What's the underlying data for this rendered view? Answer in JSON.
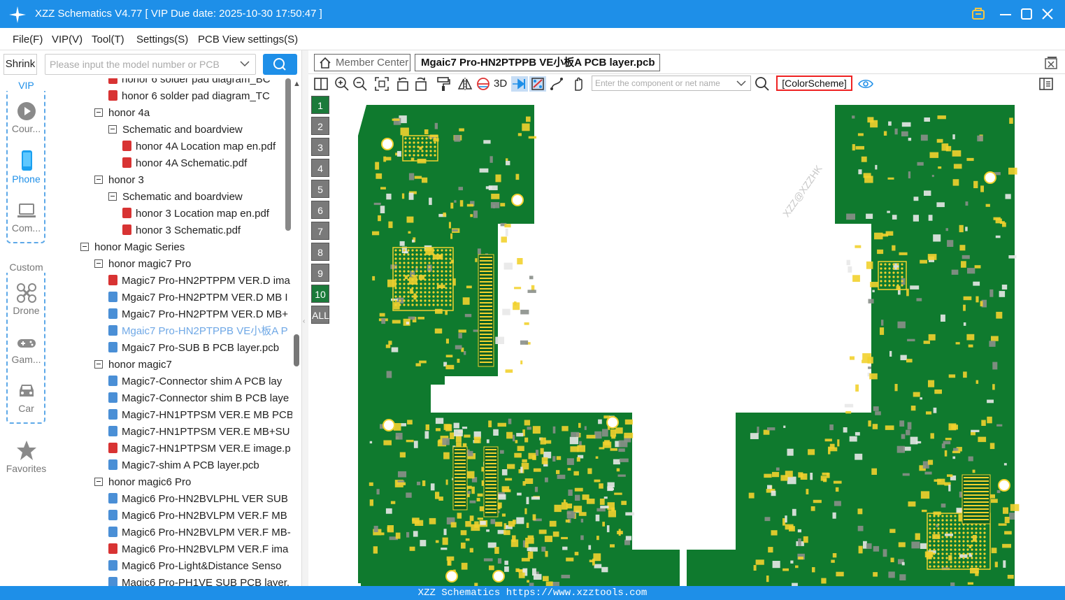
{
  "app": {
    "title": "XZZ Schematics V4.77 [ VIP Due date: 2025-10-30 17:50:47 ]",
    "accent": "#1e8fe8",
    "icons": [
      "app-logo-icon",
      "vip-icon",
      "minimize-icon",
      "maximize-icon",
      "close-icon"
    ]
  },
  "menu": [
    "File(F)",
    "VIP(V)",
    "Tool(T)",
    "Settings(S)",
    "PCB View settings(S)"
  ],
  "search": {
    "shrink_label": "Shrink",
    "placeholder": "Please input the model number or PCB"
  },
  "rail": {
    "vip_label": "VIP",
    "custom_label": "Custom",
    "items": [
      {
        "label": "Cour...",
        "icon": "play-icon"
      },
      {
        "label": "Phone",
        "icon": "phone-icon"
      },
      {
        "label": "Com...",
        "icon": "laptop-icon"
      },
      {
        "label": "Drone",
        "icon": "drone-icon"
      },
      {
        "label": "Gam...",
        "icon": "gamepad-icon"
      },
      {
        "label": "Car",
        "icon": "car-icon"
      },
      {
        "label": "Favorites",
        "icon": "star-icon"
      }
    ]
  },
  "tree": [
    {
      "label": "honor 6 solder pad diagram_BC",
      "type": "pdf",
      "level": 3
    },
    {
      "label": "honor 6 solder pad diagram_TC",
      "type": "pdf",
      "level": 3
    },
    {
      "label": "honor 4a",
      "type": "folder",
      "level": 2
    },
    {
      "label": "Schematic and boardview",
      "type": "folder",
      "level": 3
    },
    {
      "label": "honor 4A Location map en.pdf",
      "type": "pdf",
      "level": 4
    },
    {
      "label": "honor 4A Schematic.pdf",
      "type": "pdf",
      "level": 4
    },
    {
      "label": "honor 3",
      "type": "folder",
      "level": 2
    },
    {
      "label": "Schematic and boardview",
      "type": "folder",
      "level": 3
    },
    {
      "label": "honor 3 Location map en.pdf",
      "type": "pdf",
      "level": 4
    },
    {
      "label": "honor 3 Schematic.pdf",
      "type": "pdf",
      "level": 4
    },
    {
      "label": "honor Magic Series",
      "type": "folder",
      "level": 1
    },
    {
      "label": "honor magic7 Pro",
      "type": "folder",
      "level": 2
    },
    {
      "label": "Magic7 Pro-HN2PTPPM VER.D ima",
      "type": "pdf",
      "level": 3
    },
    {
      "label": "Mgaic7 Pro-HN2PTPM VER.D MB I",
      "type": "pcb",
      "level": 3
    },
    {
      "label": "Mgaic7 Pro-HN2PTPM VER.D MB+",
      "type": "pcb",
      "level": 3
    },
    {
      "label": "Mgaic7 Pro-HN2PTPPB VE小板A P",
      "type": "pcb",
      "level": 3,
      "selected": true
    },
    {
      "label": "Mgaic7 Pro-SUB B PCB layer.pcb",
      "type": "pcb",
      "level": 3
    },
    {
      "label": "honor magic7",
      "type": "folder",
      "level": 2
    },
    {
      "label": "Magic7-Connector shim A PCB lay",
      "type": "pcb",
      "level": 3
    },
    {
      "label": "Magic7-Connector shim B PCB laye",
      "type": "pcb",
      "level": 3
    },
    {
      "label": "Magic7-HN1PTPSM VER.E MB PCB",
      "type": "pcb",
      "level": 3
    },
    {
      "label": "Magic7-HN1PTPSM VER.E MB+SU",
      "type": "pcb",
      "level": 3
    },
    {
      "label": "Magic7-HN1PTPSM VER.E image.p",
      "type": "pdf",
      "level": 3
    },
    {
      "label": "Magic7-shim A PCB layer.pcb",
      "type": "pcb",
      "level": 3
    },
    {
      "label": "honor magic6 Pro",
      "type": "folder",
      "level": 2
    },
    {
      "label": "Magic6 Pro-HN2BVLPHL VER SUB",
      "type": "pcb",
      "level": 3
    },
    {
      "label": "Magic6 Pro-HN2BVLPM VER.F MB",
      "type": "pcb",
      "level": 3
    },
    {
      "label": "Magic6 Pro-HN2BVLPM VER.F MB-",
      "type": "pcb",
      "level": 3
    },
    {
      "label": "Magic6 Pro-HN2BVLPM VER.F ima",
      "type": "pdf",
      "level": 3
    },
    {
      "label": "Magic6 Pro-Light&Distance Senso",
      "type": "pcb",
      "level": 3
    },
    {
      "label": "Magic6 Pro-PH1VE SUB PCB layer.",
      "type": "pcb",
      "level": 3
    }
  ],
  "tabs": {
    "member": "Member Center",
    "active": "Mgaic7 Pro-HN2PTPPB VE小板A PCB layer.pcb"
  },
  "toolbar": {
    "three_d": "3D",
    "component_placeholder": "Enter the component or net name",
    "colorscheme": "[ColorScheme]"
  },
  "layers": [
    "1",
    "2",
    "3",
    "4",
    "5",
    "6",
    "7",
    "8",
    "9",
    "10",
    "ALL"
  ],
  "board": {
    "watermark": "XZZ@XZZHK",
    "board_color": "#0f7a2e",
    "pad_color": "#f2d22e"
  },
  "status": "XZZ Schematics https://www.xzztools.com"
}
